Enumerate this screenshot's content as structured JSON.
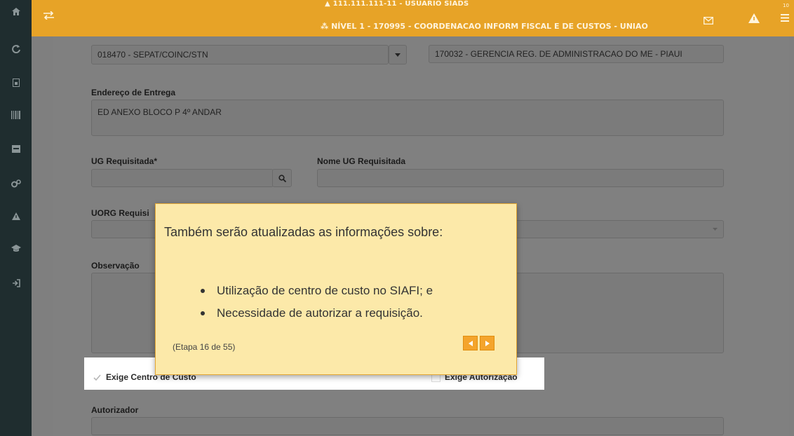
{
  "header": {
    "user_line": "▲ 111.111.111-11 - USUARIO SIADS",
    "level_line": "NÍVEL 1 - 170995 - COORDENACAO INFORM FISCAL E DE CUSTOS - UNIAO",
    "notifications_count": "10"
  },
  "form": {
    "org_select_value": "018470 - SEPAT/COINC/STN",
    "ug_name_value": "170032 - GERENCIA REG. DE ADMINISTRACAO DO ME - PIAUI",
    "delivery_address_label": "Endereço de Entrega",
    "delivery_address_value": "ED ANEXO BLOCO P 4º ANDAR",
    "ug_requested_label": "UG Requisitada*",
    "ug_requested_value": "",
    "ug_requested_name_label": "Nome UG Requisitada",
    "uorg_label": "UORG Requisi",
    "observation_label": "Observação",
    "exige_centro_label": "Exige Centro de Custo",
    "exige_centro_checked": true,
    "exige_autorizacao_label": "Exige Autorização",
    "exige_autorizacao_checked": false,
    "autorizador_label": "Autorizador"
  },
  "tour": {
    "title": "Também serão atualizadas as informações sobre:",
    "bullets": [
      "Utilização de centro de custo no SIAFI; e",
      "Necessidade de autorizar a requisição."
    ],
    "step_text": "(Etapa 16 de 55)"
  },
  "colors": {
    "topbar": "#e7a327",
    "sidebar": "#1f2d2f",
    "popover_bg": "#fce9a9",
    "popover_border": "#e4a733",
    "nav_button": "#f4a42c"
  },
  "icons": {
    "sidebar": [
      "home-icon",
      "refresh-icon",
      "document-icon",
      "barcode-icon",
      "inbox-icon",
      "cogs-icon",
      "warning-icon",
      "graduation-cap-icon",
      "sign-in-icon"
    ],
    "topbar": [
      "exchange-icon",
      "envelope-icon",
      "alert-icon",
      "menu-icon"
    ]
  }
}
